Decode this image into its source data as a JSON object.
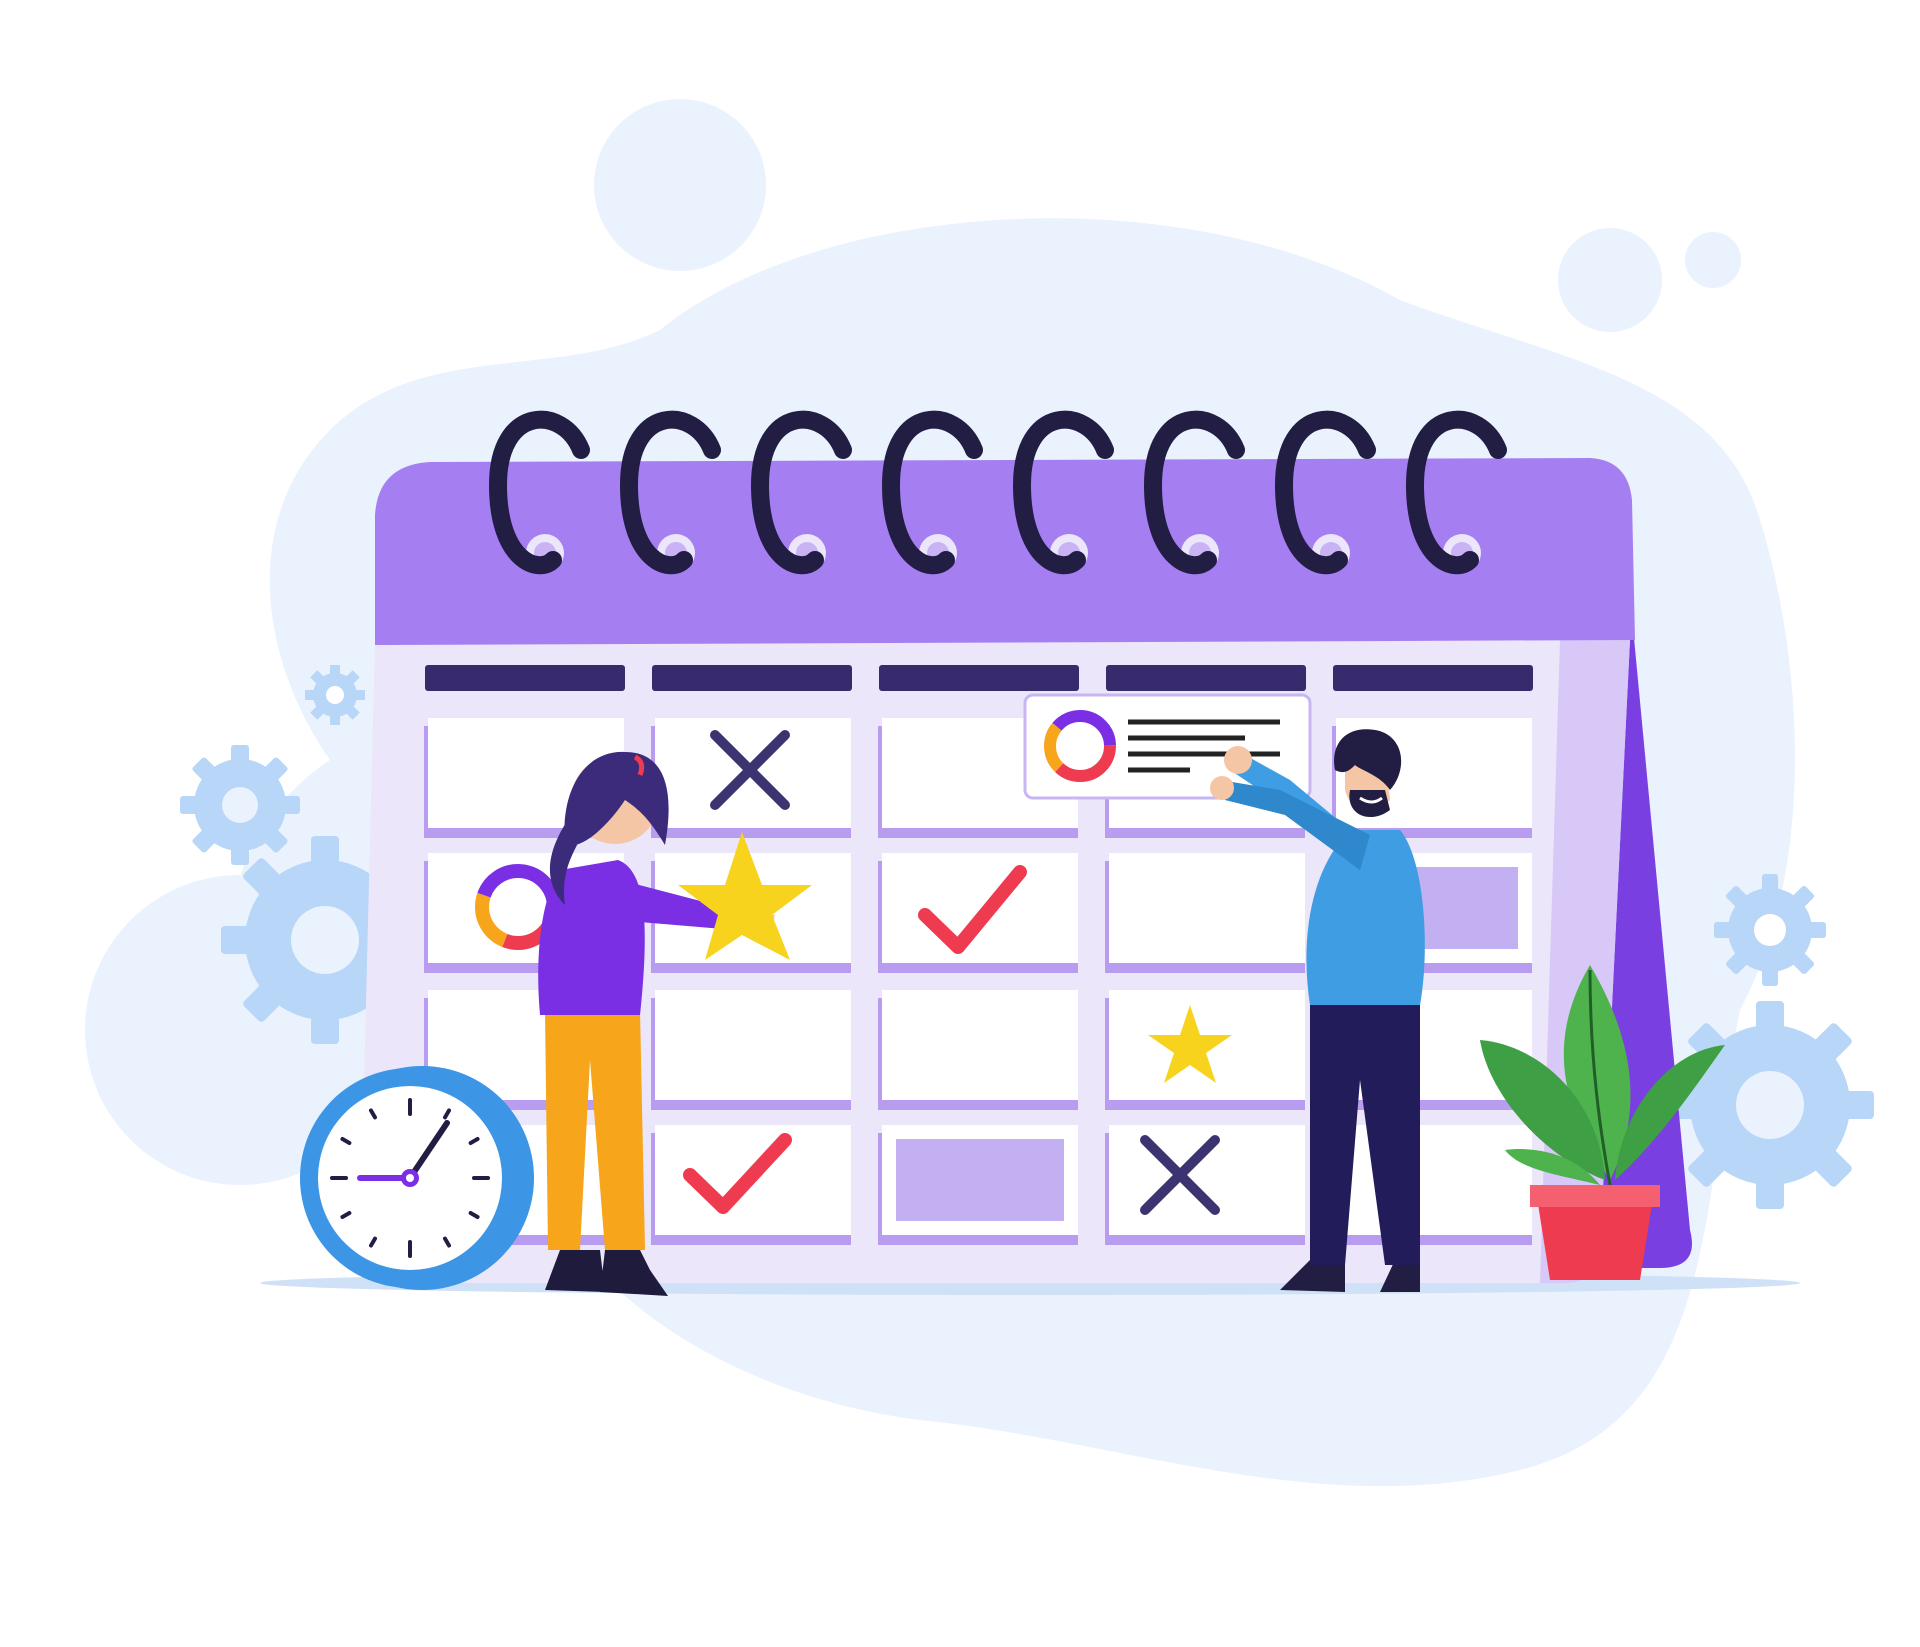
{
  "illustration": {
    "subject": "calendar-schedule-planning",
    "colors": {
      "calendar_purple": "#a57ff2",
      "calendar_side": "#7a3fe0",
      "calendar_body": "#ece6fb",
      "header_bar": "#372b6e",
      "ring": "#221d43",
      "check": "#ef3b50",
      "star": "#f7d31e",
      "cross": "#3b3470",
      "blob": "#eaf2fd",
      "gear": "#b8d6f7",
      "clock": "#3d95e6",
      "plant_green": "#4fb34d",
      "pot": "#ef3b50",
      "woman_top": "#7a2fe4",
      "woman_pants": "#f7a51a",
      "man_top": "#3e9de3",
      "man_pants": "#221d5a"
    },
    "calendar": {
      "columns": 5,
      "rows": 4,
      "rings": 8,
      "cell_marks": [
        [
          "blank",
          "cross",
          "blank",
          "blank",
          "blank"
        ],
        [
          "donut",
          "star",
          "check",
          "blank",
          "filled"
        ],
        [
          "blank",
          "blank",
          "blank",
          "star-small",
          "blank"
        ],
        [
          "blank",
          "check",
          "filled",
          "cross",
          "blank"
        ]
      ]
    },
    "icons": [
      "gear-icon",
      "clock-icon",
      "star-icon",
      "check-icon",
      "cross-icon",
      "donut-chart-icon",
      "plant-icon"
    ]
  }
}
